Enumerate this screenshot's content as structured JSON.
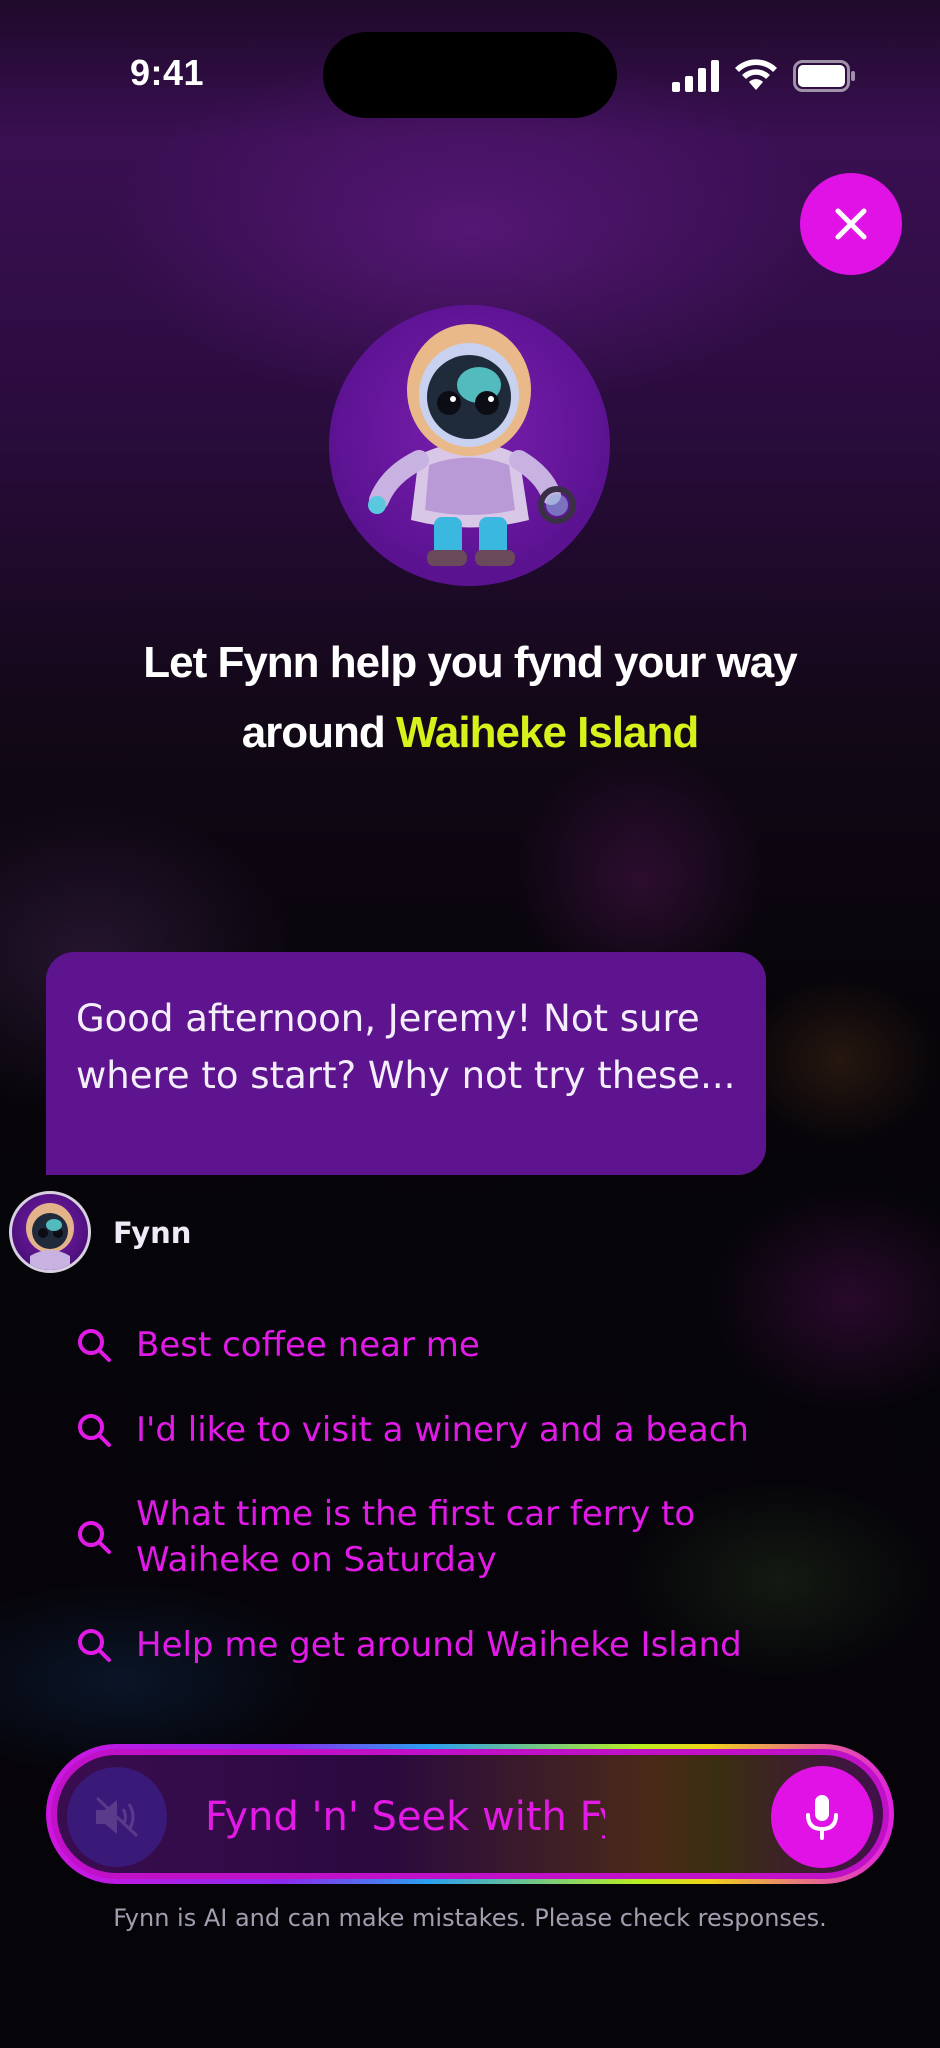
{
  "status_bar": {
    "time": "9:41"
  },
  "headline": {
    "line1": "Let Fynn help you fynd your way",
    "line2_prefix": "around ",
    "line2_accent": "Waiheke Island"
  },
  "chat": {
    "message": "Good afternoon, Jeremy! Not sure where to start? Why not try these...",
    "sender": "Fynn"
  },
  "suggestions": [
    {
      "label": "Best coffee near me",
      "icon": "search-icon"
    },
    {
      "label": "I'd like to visit a winery and a beach",
      "icon": "search-icon"
    },
    {
      "label": "What time is the first car ferry to Waiheke on Saturday",
      "icon": "search-icon"
    },
    {
      "label": "Help me get around Waiheke Island",
      "icon": "search-icon"
    }
  ],
  "input": {
    "placeholder": "Fynd 'n' Seek with Fynn...",
    "mute_icon": "speaker-muted-icon",
    "mic_icon": "microphone-icon"
  },
  "disclaimer": "Fynn is AI and can make mistakes. Please check responses.",
  "colors": {
    "accent_magenta": "#e012e6",
    "accent_lime": "#d6f21a",
    "bubble_purple": "#5e148f"
  }
}
